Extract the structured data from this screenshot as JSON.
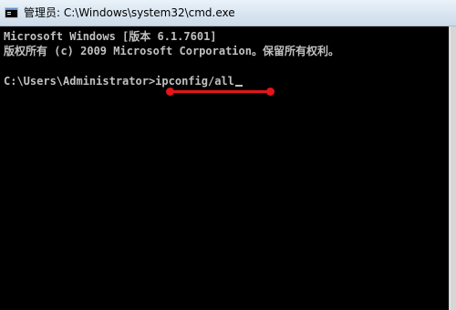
{
  "titlebar": {
    "title": "管理员: C:\\Windows\\system32\\cmd.exe",
    "icon": "cmd-app-icon"
  },
  "console": {
    "line1": "Microsoft Windows [版本 6.1.7601]",
    "line2": "版权所有 (c) 2009 Microsoft Corporation。保留所有权利。",
    "prompt": "C:\\Users\\Administrator>",
    "command": "ipconfig/all",
    "text_color": "#c0c0c0",
    "background_color": "#000000"
  },
  "annotation": {
    "color": "#e3151a"
  }
}
